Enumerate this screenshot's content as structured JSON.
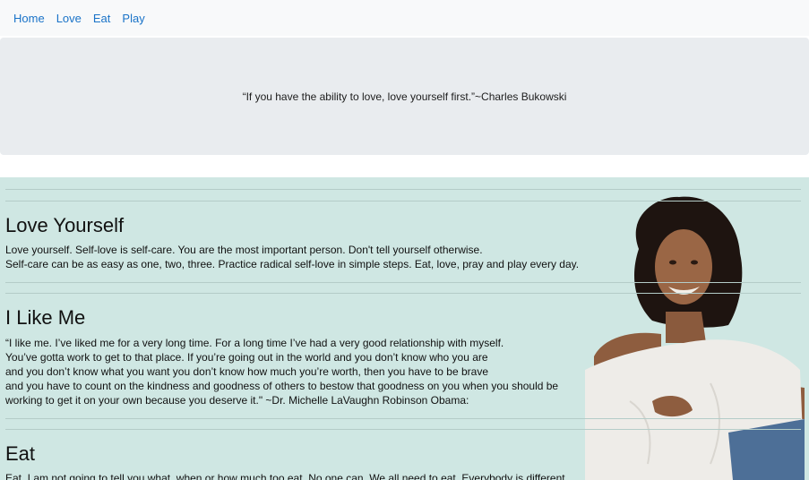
{
  "nav": {
    "items": [
      "Home",
      "Love",
      "Eat",
      "Play"
    ]
  },
  "jumbotron": {
    "quote": "“If you have the ability to love, love yourself first.”~Charles Bukowski"
  },
  "sections": [
    {
      "title": "Love Yourself",
      "lines": [
        "Love yourself. Self-love is self-care. You are the most important person. Don't tell yourself otherwise.",
        "Self-care can be as easy as one, two, three. Practice radical self-love in simple steps. Eat, love, pray and play every day."
      ]
    },
    {
      "title": "I Like Me",
      "lines": [
        "“I like me. I’ve liked me for a very long time. For a long time I’ve had a very good relationship with myself.",
        "You’ve gotta work to get to that place. If you’re going out in the world and you don’t know who you are",
        "and you don’t know what you want you don’t know how much you’re worth, then you have to be brave",
        "and you have to count on the kindness and goodness of others to bestow that goodness on you when you should be",
        "working to get it on your own because you deserve it.\" ~Dr. Michelle LaVaughn Robinson Obama:"
      ]
    },
    {
      "title": "Eat",
      "lines": [
        "Eat. I am not going to tell you what, when or how much too eat. No one can. We all need to eat. Everybody is different"
      ]
    }
  ],
  "colors": {
    "nav_link": "#1a73c8",
    "jumbotron_bg": "#e9ecef",
    "content_bg": "#cfe7e3"
  },
  "photo": {
    "subject": "smiling woman portrait"
  }
}
